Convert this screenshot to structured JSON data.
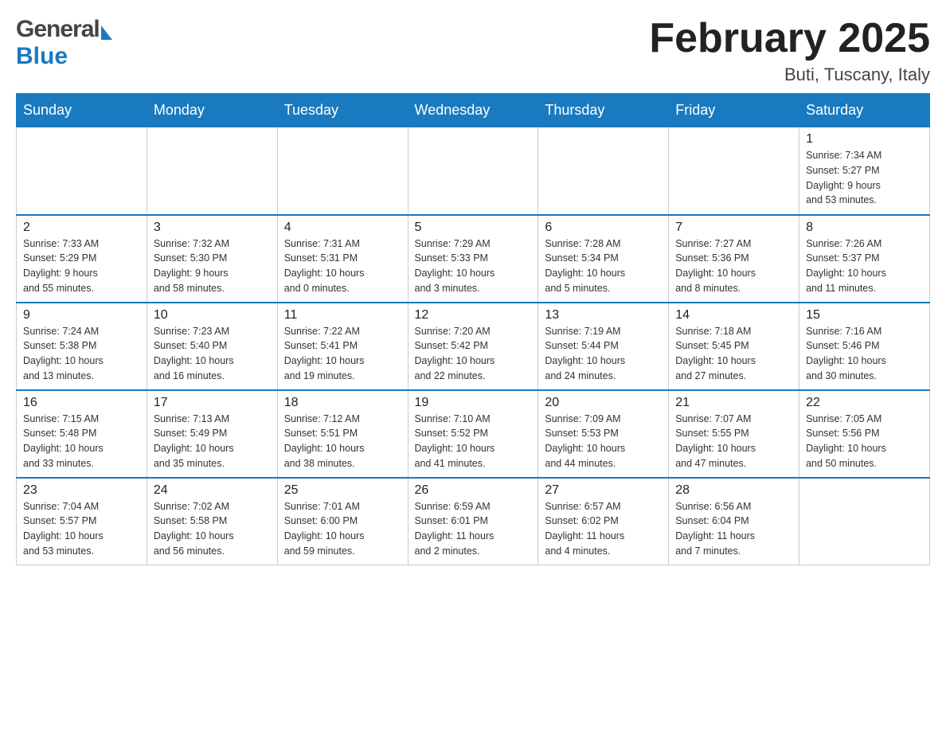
{
  "header": {
    "logo_general": "General",
    "logo_blue": "Blue",
    "month_title": "February 2025",
    "location": "Buti, Tuscany, Italy"
  },
  "days_of_week": [
    "Sunday",
    "Monday",
    "Tuesday",
    "Wednesday",
    "Thursday",
    "Friday",
    "Saturday"
  ],
  "weeks": [
    [
      {
        "day": "",
        "info": ""
      },
      {
        "day": "",
        "info": ""
      },
      {
        "day": "",
        "info": ""
      },
      {
        "day": "",
        "info": ""
      },
      {
        "day": "",
        "info": ""
      },
      {
        "day": "",
        "info": ""
      },
      {
        "day": "1",
        "info": "Sunrise: 7:34 AM\nSunset: 5:27 PM\nDaylight: 9 hours\nand 53 minutes."
      }
    ],
    [
      {
        "day": "2",
        "info": "Sunrise: 7:33 AM\nSunset: 5:29 PM\nDaylight: 9 hours\nand 55 minutes."
      },
      {
        "day": "3",
        "info": "Sunrise: 7:32 AM\nSunset: 5:30 PM\nDaylight: 9 hours\nand 58 minutes."
      },
      {
        "day": "4",
        "info": "Sunrise: 7:31 AM\nSunset: 5:31 PM\nDaylight: 10 hours\nand 0 minutes."
      },
      {
        "day": "5",
        "info": "Sunrise: 7:29 AM\nSunset: 5:33 PM\nDaylight: 10 hours\nand 3 minutes."
      },
      {
        "day": "6",
        "info": "Sunrise: 7:28 AM\nSunset: 5:34 PM\nDaylight: 10 hours\nand 5 minutes."
      },
      {
        "day": "7",
        "info": "Sunrise: 7:27 AM\nSunset: 5:36 PM\nDaylight: 10 hours\nand 8 minutes."
      },
      {
        "day": "8",
        "info": "Sunrise: 7:26 AM\nSunset: 5:37 PM\nDaylight: 10 hours\nand 11 minutes."
      }
    ],
    [
      {
        "day": "9",
        "info": "Sunrise: 7:24 AM\nSunset: 5:38 PM\nDaylight: 10 hours\nand 13 minutes."
      },
      {
        "day": "10",
        "info": "Sunrise: 7:23 AM\nSunset: 5:40 PM\nDaylight: 10 hours\nand 16 minutes."
      },
      {
        "day": "11",
        "info": "Sunrise: 7:22 AM\nSunset: 5:41 PM\nDaylight: 10 hours\nand 19 minutes."
      },
      {
        "day": "12",
        "info": "Sunrise: 7:20 AM\nSunset: 5:42 PM\nDaylight: 10 hours\nand 22 minutes."
      },
      {
        "day": "13",
        "info": "Sunrise: 7:19 AM\nSunset: 5:44 PM\nDaylight: 10 hours\nand 24 minutes."
      },
      {
        "day": "14",
        "info": "Sunrise: 7:18 AM\nSunset: 5:45 PM\nDaylight: 10 hours\nand 27 minutes."
      },
      {
        "day": "15",
        "info": "Sunrise: 7:16 AM\nSunset: 5:46 PM\nDaylight: 10 hours\nand 30 minutes."
      }
    ],
    [
      {
        "day": "16",
        "info": "Sunrise: 7:15 AM\nSunset: 5:48 PM\nDaylight: 10 hours\nand 33 minutes."
      },
      {
        "day": "17",
        "info": "Sunrise: 7:13 AM\nSunset: 5:49 PM\nDaylight: 10 hours\nand 35 minutes."
      },
      {
        "day": "18",
        "info": "Sunrise: 7:12 AM\nSunset: 5:51 PM\nDaylight: 10 hours\nand 38 minutes."
      },
      {
        "day": "19",
        "info": "Sunrise: 7:10 AM\nSunset: 5:52 PM\nDaylight: 10 hours\nand 41 minutes."
      },
      {
        "day": "20",
        "info": "Sunrise: 7:09 AM\nSunset: 5:53 PM\nDaylight: 10 hours\nand 44 minutes."
      },
      {
        "day": "21",
        "info": "Sunrise: 7:07 AM\nSunset: 5:55 PM\nDaylight: 10 hours\nand 47 minutes."
      },
      {
        "day": "22",
        "info": "Sunrise: 7:05 AM\nSunset: 5:56 PM\nDaylight: 10 hours\nand 50 minutes."
      }
    ],
    [
      {
        "day": "23",
        "info": "Sunrise: 7:04 AM\nSunset: 5:57 PM\nDaylight: 10 hours\nand 53 minutes."
      },
      {
        "day": "24",
        "info": "Sunrise: 7:02 AM\nSunset: 5:58 PM\nDaylight: 10 hours\nand 56 minutes."
      },
      {
        "day": "25",
        "info": "Sunrise: 7:01 AM\nSunset: 6:00 PM\nDaylight: 10 hours\nand 59 minutes."
      },
      {
        "day": "26",
        "info": "Sunrise: 6:59 AM\nSunset: 6:01 PM\nDaylight: 11 hours\nand 2 minutes."
      },
      {
        "day": "27",
        "info": "Sunrise: 6:57 AM\nSunset: 6:02 PM\nDaylight: 11 hours\nand 4 minutes."
      },
      {
        "day": "28",
        "info": "Sunrise: 6:56 AM\nSunset: 6:04 PM\nDaylight: 11 hours\nand 7 minutes."
      },
      {
        "day": "",
        "info": ""
      }
    ]
  ]
}
